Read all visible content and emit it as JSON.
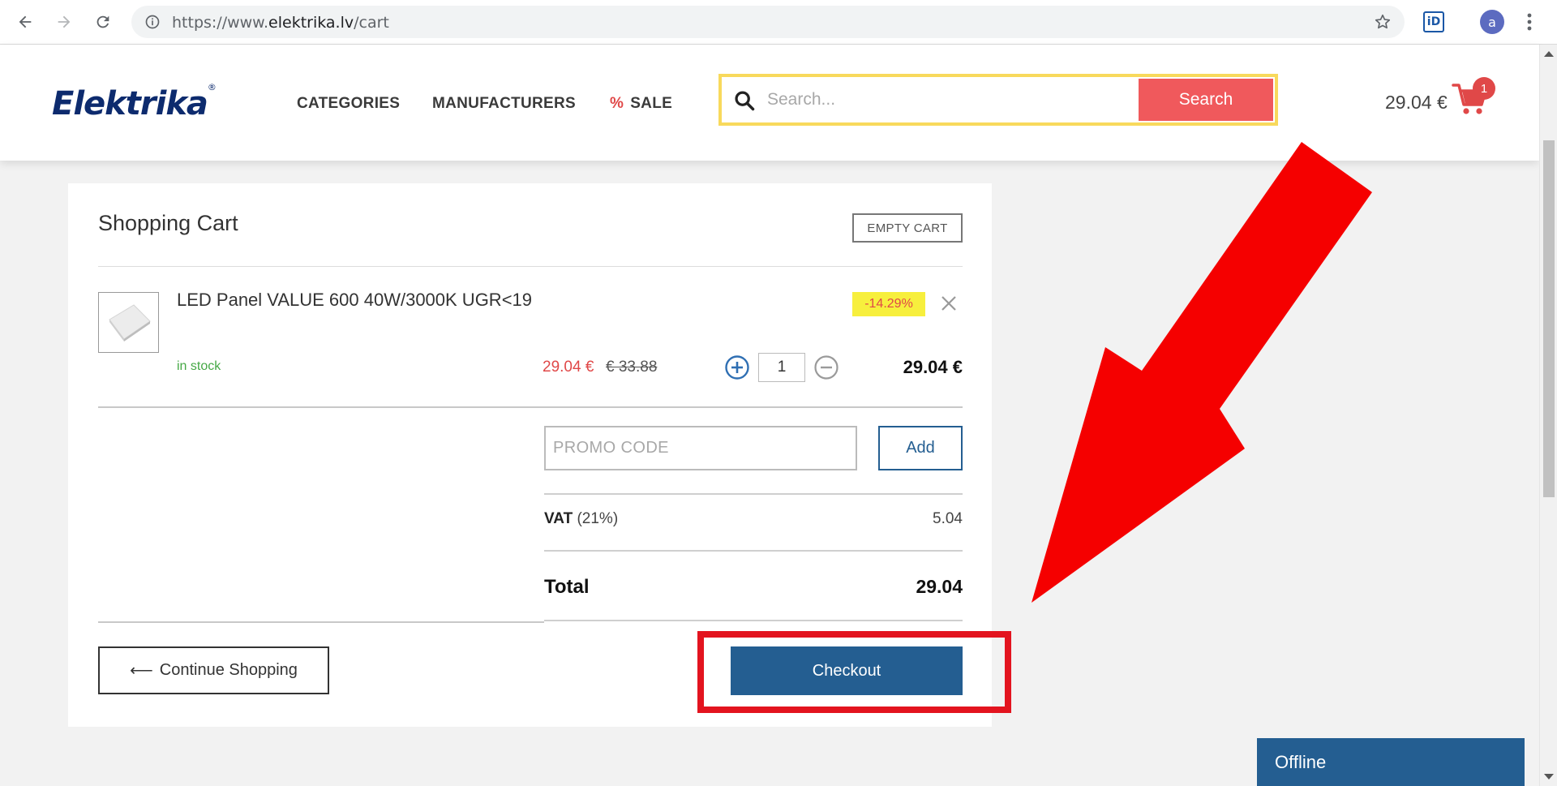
{
  "browser": {
    "url_scheme": "https://www.",
    "url_host": "elektrika.lv",
    "url_path": "/cart",
    "profile_initial": "a",
    "extension_label": "iD"
  },
  "header": {
    "logo_text": "Elektrika",
    "logo_mark": "®",
    "nav": {
      "categories": "CATEGORIES",
      "manufacturers": "MANUFACTURERS",
      "sale_symbol": "%",
      "sale": "SALE"
    },
    "search": {
      "placeholder": "Search...",
      "button_label": "Search"
    },
    "cart": {
      "total": "29.04 €",
      "badge_count": "1"
    }
  },
  "cart": {
    "title": "Shopping Cart",
    "empty_cart_label": "EMPTY CART",
    "item": {
      "name": "LED Panel VALUE 600 40W/3000K UGR<19",
      "stock_status": "in stock",
      "discount": "-14.29%",
      "price_sale": "29.04 €",
      "price_old": "€ 33.88",
      "quantity": "1",
      "line_total": "29.04 €"
    },
    "promo": {
      "placeholder": "PROMO CODE",
      "add_label": "Add"
    },
    "summary": {
      "vat_label": "VAT",
      "vat_rate": "(21%)",
      "vat_value": "5.04",
      "total_label": "Total",
      "total_value": "29.04"
    },
    "continue_label": "Continue Shopping",
    "continue_arrow": "⟵",
    "checkout_label": "Checkout"
  },
  "chat": {
    "status": "Offline"
  },
  "colors": {
    "brand_navy": "#0d2b6e",
    "accent_red": "#f0595c",
    "primary_blue": "#245e91",
    "highlight_yellow": "#f8d95c",
    "annotation_red": "#e3141f",
    "stock_green": "#45a845"
  }
}
